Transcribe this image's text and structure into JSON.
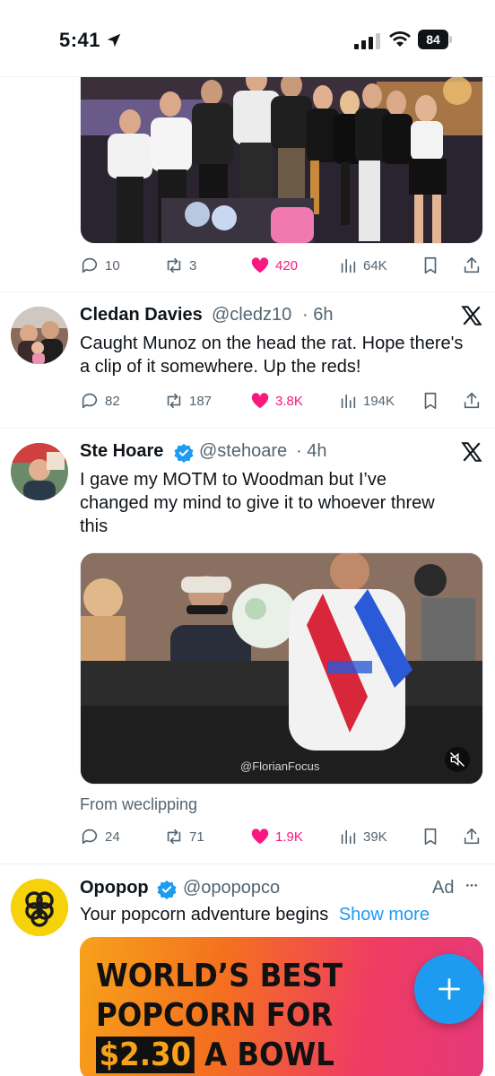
{
  "status_bar": {
    "time": "5:41",
    "battery": "84"
  },
  "tweet1": {
    "stats": {
      "replies": "10",
      "retweets": "3",
      "likes": "420",
      "views": "64K"
    }
  },
  "tweet2": {
    "name": "Cledan Davies",
    "handle": "@cledz10",
    "time": "· 6h",
    "text": "Caught Munoz on the head the rat. Hope there's a clip of it somewhere. Up the reds!",
    "stats": {
      "replies": "82",
      "retweets": "187",
      "likes": "3.8K",
      "views": "194K"
    }
  },
  "tweet3": {
    "name": "Ste Hoare",
    "handle": "@stehoare",
    "time": "· 4h",
    "text": "I gave my MOTM to Woodman but I’ve changed my mind to give it to whoever threw this",
    "video_watermark": "@FlorianFocus",
    "source": "From weclipping",
    "stats": {
      "replies": "24",
      "retweets": "71",
      "likes": "1.9K",
      "views": "39K"
    }
  },
  "tweet4": {
    "name": "Opopop",
    "handle": "@opopopco",
    "ad_label": "Ad",
    "text": "Your popcorn adventure begins",
    "show_more": "Show more",
    "ad_lines": [
      "WORLD’S BEST",
      "POPCORN FOR",
      "$2.30",
      "A BOWL"
    ]
  },
  "colors": {
    "like": "#f91880",
    "accent": "#1d9bf0",
    "muted": "#536471"
  }
}
